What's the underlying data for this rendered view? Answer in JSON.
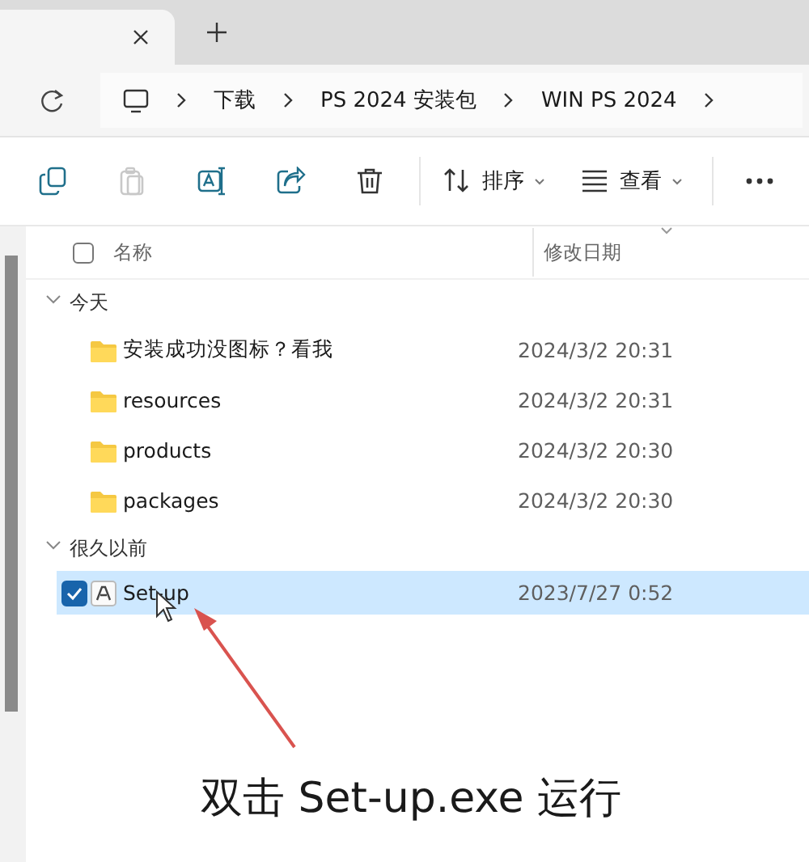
{
  "tabs": [
    {
      "selected": true
    }
  ],
  "breadcrumb": [
    "下载",
    "PS 2024 安装包",
    "WIN PS 2024"
  ],
  "toolbar": [
    {
      "kind": "copy",
      "disabled": false
    },
    {
      "kind": "paste",
      "disabled": true
    },
    {
      "kind": "rename",
      "disabled": false
    },
    {
      "kind": "share",
      "disabled": false
    },
    {
      "kind": "delete",
      "disabled": false
    },
    {
      "kind": "sort",
      "label": "排序",
      "disabled": false
    },
    {
      "kind": "view",
      "label": "查看",
      "disabled": false
    },
    {
      "kind": "more",
      "disabled": false
    }
  ],
  "columns": [
    {
      "label": "名称",
      "checked": false
    },
    {
      "label": "修改日期"
    }
  ],
  "groups": [
    {
      "label": "今天",
      "expanded": true,
      "items": [
        {
          "name": "安装成功没图标？看我",
          "date": "2024/3/2 20:31",
          "kind": "folder",
          "selected": false
        },
        {
          "name": "resources",
          "date": "2024/3/2 20:31",
          "kind": "folder",
          "selected": false
        },
        {
          "name": "products",
          "date": "2024/3/2 20:30",
          "kind": "folder",
          "selected": false
        },
        {
          "name": "packages",
          "date": "2024/3/2 20:30",
          "kind": "folder",
          "selected": false
        }
      ]
    },
    {
      "label": "很久以前",
      "expanded": true,
      "items": [
        {
          "name": "Set-up",
          "date": "2023/7/27 0:52",
          "kind": "app",
          "selected": true
        }
      ]
    }
  ],
  "caption": "双击 Set-up.exe 运行"
}
